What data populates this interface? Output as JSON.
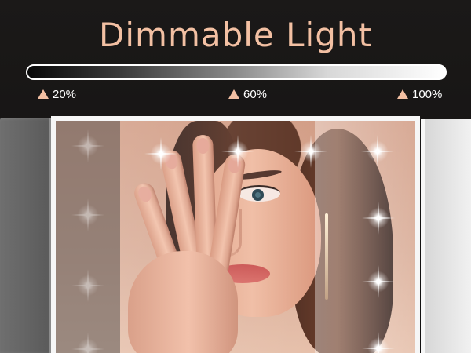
{
  "title": "Dimmable Light",
  "brightness_scale": {
    "levels": [
      {
        "label": "20%",
        "value": 20
      },
      {
        "label": "60%",
        "value": 60
      },
      {
        "label": "100%",
        "value": 100
      }
    ],
    "gradient_start_color": "#000000",
    "gradient_end_color": "#ffffff"
  },
  "colors": {
    "title": "#f3c0a3",
    "marker": "#f3c0a3",
    "background": "#151312",
    "mirror_frame": "#f6f6f6"
  },
  "icons": {
    "level_marker": "triangle-up-icon",
    "light": "led-light-icon"
  }
}
